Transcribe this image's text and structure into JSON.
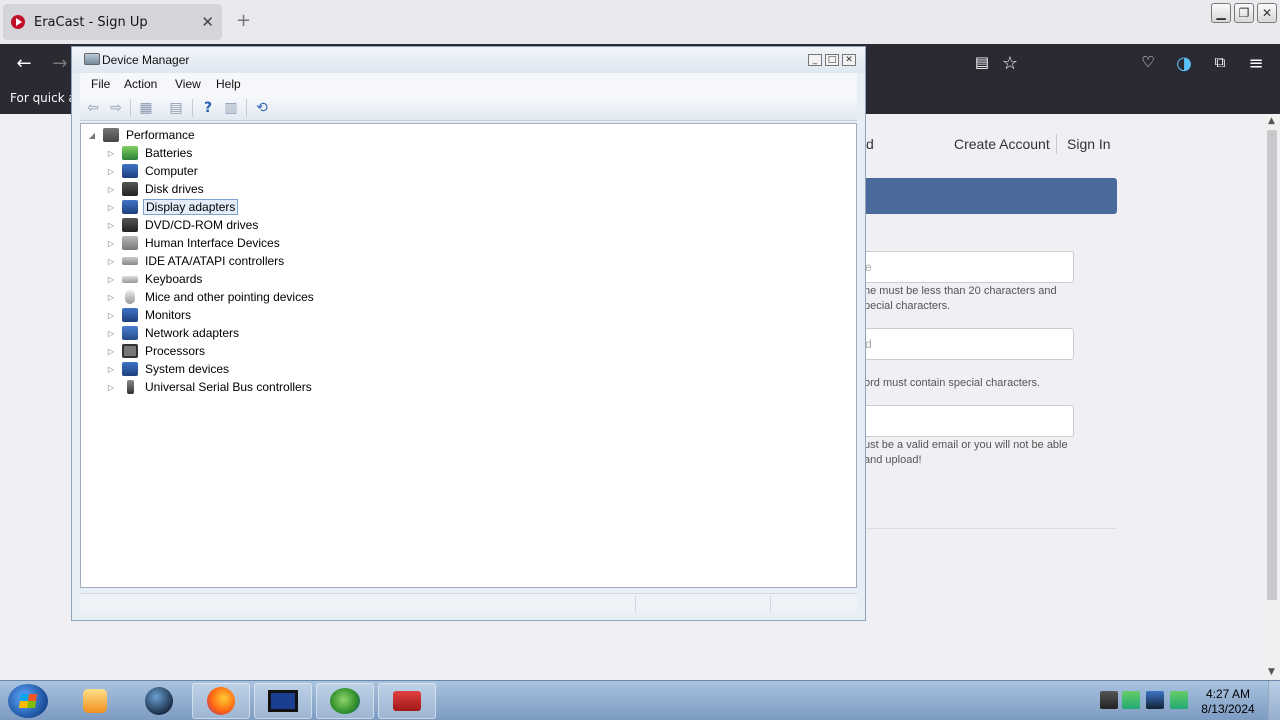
{
  "browser": {
    "tab_title": "EraCast - Sign Up",
    "tab_close": "✕",
    "new_tab": "+",
    "bookmarks_hint": "For quick ac"
  },
  "page": {
    "nav_fragment": "d",
    "create_account": "Create Account",
    "sign_in": "Sign In",
    "username_placeholder": "e",
    "username_hint_1": "ne must be less than 20 characters and",
    "username_hint_2": "pecial characters.",
    "password_placeholder": "d",
    "password_hint": "ord must contain special characters.",
    "email_hint_1": "ust be a valid email or you will not be able",
    "email_hint_2": "and upload!"
  },
  "device_manager": {
    "title": "Device Manager",
    "menu": [
      "File",
      "Action",
      "View",
      "Help"
    ],
    "root": "Performance",
    "items": [
      "Batteries",
      "Computer",
      "Disk drives",
      "Display adapters",
      "DVD/CD-ROM drives",
      "Human Interface Devices",
      "IDE ATA/ATAPI controllers",
      "Keyboards",
      "Mice and other pointing devices",
      "Monitors",
      "Network adapters",
      "Processors",
      "System devices",
      "Universal Serial Bus controllers"
    ],
    "selected": "Display adapters"
  },
  "taskbar": {
    "time": "4:27 AM",
    "date": "8/13/2024"
  },
  "colors": {
    "browser_toolbar": "#2b2a33",
    "banner": "#4a6a9b",
    "selection": "#e4eefb"
  }
}
